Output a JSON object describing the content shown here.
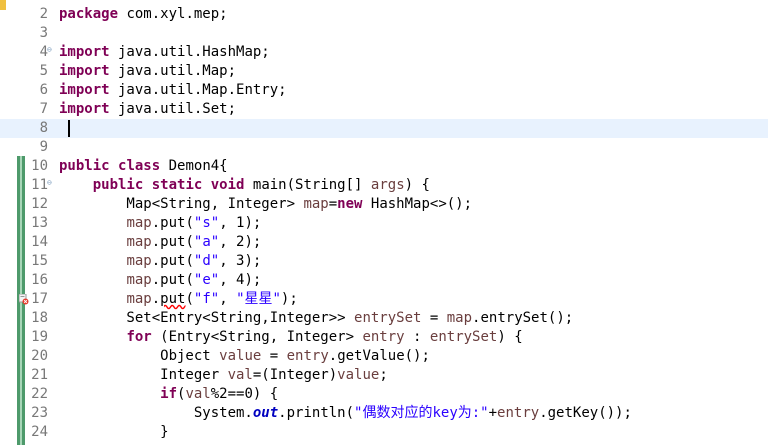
{
  "editor": {
    "colors": {
      "keyword": "#7f0055",
      "string": "#2a00ff",
      "local_variable": "#6a3e3e",
      "static_field": "#0000c0",
      "line_number": "#787878",
      "current_line": "#e8f2fe",
      "change_ruler": "#4e9a6b"
    },
    "lines": [
      {
        "num": "2",
        "tokens": [
          {
            "t": "package",
            "c": "kw"
          },
          {
            "t": " com.xyl.mep;"
          }
        ]
      },
      {
        "num": "3",
        "tokens": []
      },
      {
        "num": "4",
        "fold": "⊖",
        "tokens": [
          {
            "t": "import",
            "c": "kw"
          },
          {
            "t": " java.util.HashMap;"
          }
        ]
      },
      {
        "num": "5",
        "tokens": [
          {
            "t": "import",
            "c": "kw"
          },
          {
            "t": " java.util.Map;"
          }
        ]
      },
      {
        "num": "6",
        "tokens": [
          {
            "t": "import",
            "c": "kw"
          },
          {
            "t": " java.util.Map.Entry;"
          }
        ]
      },
      {
        "num": "7",
        "tokens": [
          {
            "t": "import",
            "c": "kw"
          },
          {
            "t": " java.util.Set;"
          }
        ]
      },
      {
        "num": "8",
        "current": true,
        "caret": true,
        "tokens": []
      },
      {
        "num": "9",
        "tokens": []
      },
      {
        "num": "10",
        "tokens": [
          {
            "t": "public",
            "c": "kw"
          },
          {
            "t": " "
          },
          {
            "t": "class",
            "c": "kw"
          },
          {
            "t": " Demon4{"
          }
        ]
      },
      {
        "num": "11",
        "fold": "⊖",
        "tokens": [
          {
            "t": "    "
          },
          {
            "t": "public",
            "c": "kw"
          },
          {
            "t": " "
          },
          {
            "t": "static",
            "c": "kw"
          },
          {
            "t": " "
          },
          {
            "t": "void",
            "c": "kw"
          },
          {
            "t": " main(String[] "
          },
          {
            "t": "args",
            "c": "var"
          },
          {
            "t": ") {"
          }
        ]
      },
      {
        "num": "12",
        "tokens": [
          {
            "t": "        Map<String, Integer> "
          },
          {
            "t": "map",
            "c": "var"
          },
          {
            "t": "="
          },
          {
            "t": "new",
            "c": "kw"
          },
          {
            "t": " HashMap<>();"
          }
        ]
      },
      {
        "num": "13",
        "tokens": [
          {
            "t": "        "
          },
          {
            "t": "map",
            "c": "var"
          },
          {
            "t": ".put("
          },
          {
            "t": "\"s\"",
            "c": "str"
          },
          {
            "t": ", 1);"
          }
        ]
      },
      {
        "num": "14",
        "tokens": [
          {
            "t": "        "
          },
          {
            "t": "map",
            "c": "var"
          },
          {
            "t": ".put("
          },
          {
            "t": "\"a\"",
            "c": "str"
          },
          {
            "t": ", 2);"
          }
        ]
      },
      {
        "num": "15",
        "tokens": [
          {
            "t": "        "
          },
          {
            "t": "map",
            "c": "var"
          },
          {
            "t": ".put("
          },
          {
            "t": "\"d\"",
            "c": "str"
          },
          {
            "t": ", 3);"
          }
        ]
      },
      {
        "num": "16",
        "tokens": [
          {
            "t": "        "
          },
          {
            "t": "map",
            "c": "var"
          },
          {
            "t": ".put("
          },
          {
            "t": "\"e\"",
            "c": "str"
          },
          {
            "t": ", 4);"
          }
        ]
      },
      {
        "num": "17",
        "marker": "error",
        "tokens": [
          {
            "t": "        "
          },
          {
            "t": "map",
            "c": "var"
          },
          {
            "t": "."
          },
          {
            "t": "put",
            "c": "warn-u"
          },
          {
            "t": "("
          },
          {
            "t": "\"f\"",
            "c": "str"
          },
          {
            "t": ", "
          },
          {
            "t": "\"星星\"",
            "c": "str"
          },
          {
            "t": ");"
          }
        ]
      },
      {
        "num": "18",
        "tokens": [
          {
            "t": "        Set<Entry<String,Integer>> "
          },
          {
            "t": "entrySet",
            "c": "var"
          },
          {
            "t": " = "
          },
          {
            "t": "map",
            "c": "var"
          },
          {
            "t": ".entrySet();"
          }
        ]
      },
      {
        "num": "19",
        "tokens": [
          {
            "t": "        "
          },
          {
            "t": "for",
            "c": "kw"
          },
          {
            "t": " (Entry<String, Integer> "
          },
          {
            "t": "entry",
            "c": "var"
          },
          {
            "t": " : "
          },
          {
            "t": "entrySet",
            "c": "var"
          },
          {
            "t": ") {"
          }
        ]
      },
      {
        "num": "20",
        "tokens": [
          {
            "t": "            Object "
          },
          {
            "t": "value",
            "c": "var"
          },
          {
            "t": " = "
          },
          {
            "t": "entry",
            "c": "var"
          },
          {
            "t": ".getValue();"
          }
        ]
      },
      {
        "num": "21",
        "tokens": [
          {
            "t": "            Integer "
          },
          {
            "t": "val",
            "c": "var"
          },
          {
            "t": "=(Integer)"
          },
          {
            "t": "value",
            "c": "var"
          },
          {
            "t": ";"
          }
        ]
      },
      {
        "num": "22",
        "tokens": [
          {
            "t": "            "
          },
          {
            "t": "if",
            "c": "kw"
          },
          {
            "t": "("
          },
          {
            "t": "val",
            "c": "var"
          },
          {
            "t": "%2==0) {"
          }
        ]
      },
      {
        "num": "23",
        "tokens": [
          {
            "t": "                System."
          },
          {
            "t": "out",
            "c": "fld"
          },
          {
            "t": ".println("
          },
          {
            "t": "\"偶数对应的key为:\"",
            "c": "str"
          },
          {
            "t": "+"
          },
          {
            "t": "entry",
            "c": "var"
          },
          {
            "t": ".getKey());"
          }
        ]
      },
      {
        "num": "24",
        "tokens": [
          {
            "t": "            }"
          }
        ]
      }
    ]
  }
}
